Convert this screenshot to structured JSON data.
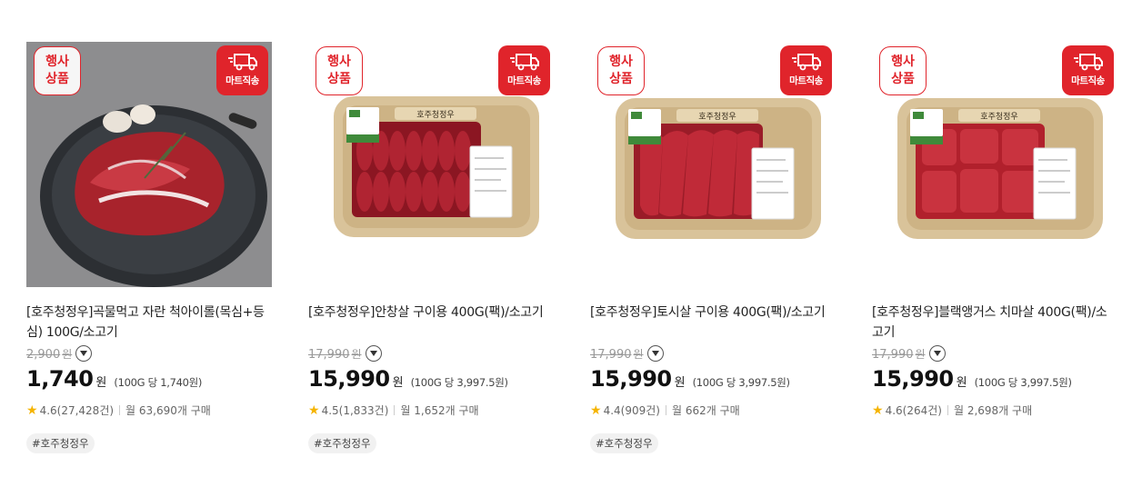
{
  "badges": {
    "event_line1": "행사",
    "event_line2": "상품",
    "mart": "마트직송"
  },
  "currency": "원",
  "products": [
    {
      "title": "[호주청정우]곡물먹고 자란 척아이롤(목심+등심) 100G/소고기",
      "original_price": "2,900",
      "price": "1,740",
      "unit_price": "(100G 당 1,740원)",
      "rating": "4.6(27,428건)",
      "monthly": "월 63,690개 구매",
      "tag": "#호주청정우",
      "image": "grilled-steak-on-pan"
    },
    {
      "title": "[호주청정우]안창살 구이용 400G(팩)/소고기",
      "original_price": "17,990",
      "price": "15,990",
      "unit_price": "(100G 당 3,997.5원)",
      "rating": "4.5(1,833건)",
      "monthly": "월 1,652개 구매",
      "tag": "#호주청정우",
      "image": "packaged-sliced-beef-tray"
    },
    {
      "title": "[호주청정우]토시살 구이용 400G(팩)/소고기",
      "original_price": "17,990",
      "price": "15,990",
      "unit_price": "(100G 당 3,997.5원)",
      "rating": "4.4(909건)",
      "monthly": "월 662개 구매",
      "tag": "#호주청정우",
      "image": "packaged-sliced-beef-tray"
    },
    {
      "title": "[호주청정우]블랙앵거스 치마살 400G(팩)/소고기",
      "original_price": "17,990",
      "price": "15,990",
      "unit_price": "(100G 당 3,997.5원)",
      "rating": "4.6(264건)",
      "monthly": "월 2,698개 구매",
      "tag": "",
      "image": "packaged-beef-block-tray"
    }
  ],
  "package_label": "호주청정우",
  "colors": {
    "accent_red": "#e0242b",
    "star": "#f5b400",
    "strike": "#999999"
  }
}
